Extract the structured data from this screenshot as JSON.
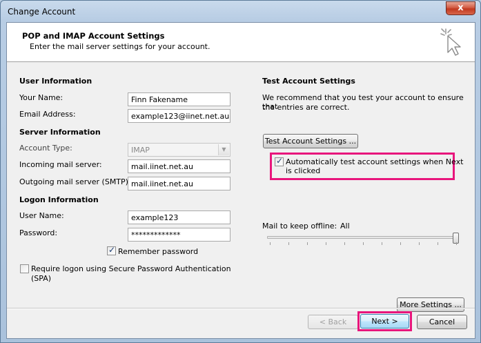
{
  "window": {
    "title": "Change Account",
    "close_glyph": "x"
  },
  "header": {
    "title": "POP and IMAP Account Settings",
    "subtitle": "Enter the mail server settings for your account.",
    "icon": "cursor-sparkle-icon"
  },
  "user_info": {
    "section_title": "User Information",
    "your_name_label": "Your Name:",
    "your_name_value": "Finn Fakename",
    "email_label": "Email Address:",
    "email_value": "example123@iinet.net.au"
  },
  "server_info": {
    "section_title": "Server Information",
    "account_type_label": "Account Type:",
    "account_type_value": "IMAP",
    "incoming_label": "Incoming mail server:",
    "incoming_value": "mail.iinet.net.au",
    "outgoing_label": "Outgoing mail server (SMTP):",
    "outgoing_value": "mail.iinet.net.au"
  },
  "logon_info": {
    "section_title": "Logon Information",
    "username_label": "User Name:",
    "username_value": "example123",
    "password_label": "Password:",
    "password_value": "*************",
    "remember_password_label": "Remember password",
    "remember_password_checked": true,
    "spa_label_line1": "Require logon using Secure Password Authentication",
    "spa_label_line2": "(SPA)",
    "spa_checked": false
  },
  "test_settings": {
    "section_title": "Test Account Settings",
    "description_line1": "We recommend that you test your account to ensure that",
    "description_line2": "the entries are correct.",
    "test_button_label": "Test Account Settings ...",
    "auto_test_label_line1": "Automatically test account settings when Next",
    "auto_test_label_line2": "is clicked",
    "auto_test_checked": true
  },
  "offline": {
    "label": "Mail to keep offline:",
    "value": "All",
    "slider_fraction": 1.0
  },
  "more_settings_label": "More Settings ...",
  "footer": {
    "back_label": "< Back",
    "next_label": "Next >",
    "cancel_label": "Cancel"
  },
  "colors": {
    "highlight": "#e8157c",
    "close_button": "#c0391f"
  }
}
